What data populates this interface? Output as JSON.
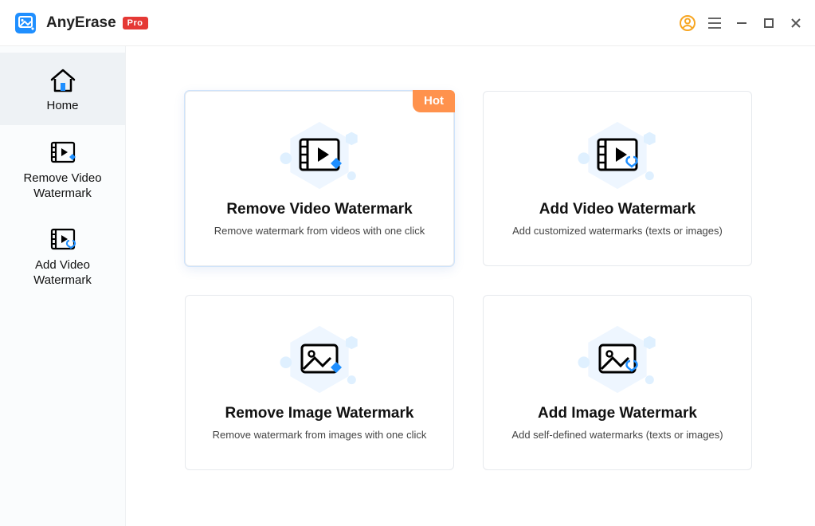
{
  "app": {
    "name": "AnyErase",
    "badge": "Pro"
  },
  "sidebar": {
    "items": [
      {
        "label": "Home"
      },
      {
        "label": "Remove Video\nWatermark"
      },
      {
        "label": "Add Video\nWatermark"
      }
    ]
  },
  "cards": {
    "remove_video": {
      "title": "Remove Video Watermark",
      "desc": "Remove watermark from videos with one click",
      "hot": "Hot"
    },
    "add_video": {
      "title": "Add Video Watermark",
      "desc": "Add customized watermarks (texts or images)"
    },
    "remove_image": {
      "title": "Remove Image Watermark",
      "desc": "Remove watermark from images with one click"
    },
    "add_image": {
      "title": "Add Image Watermark",
      "desc": "Add self-defined watermarks  (texts or images)"
    }
  },
  "colors": {
    "accent": "#1f8fff",
    "hot": "#ff924d",
    "badge": "#E53935"
  }
}
